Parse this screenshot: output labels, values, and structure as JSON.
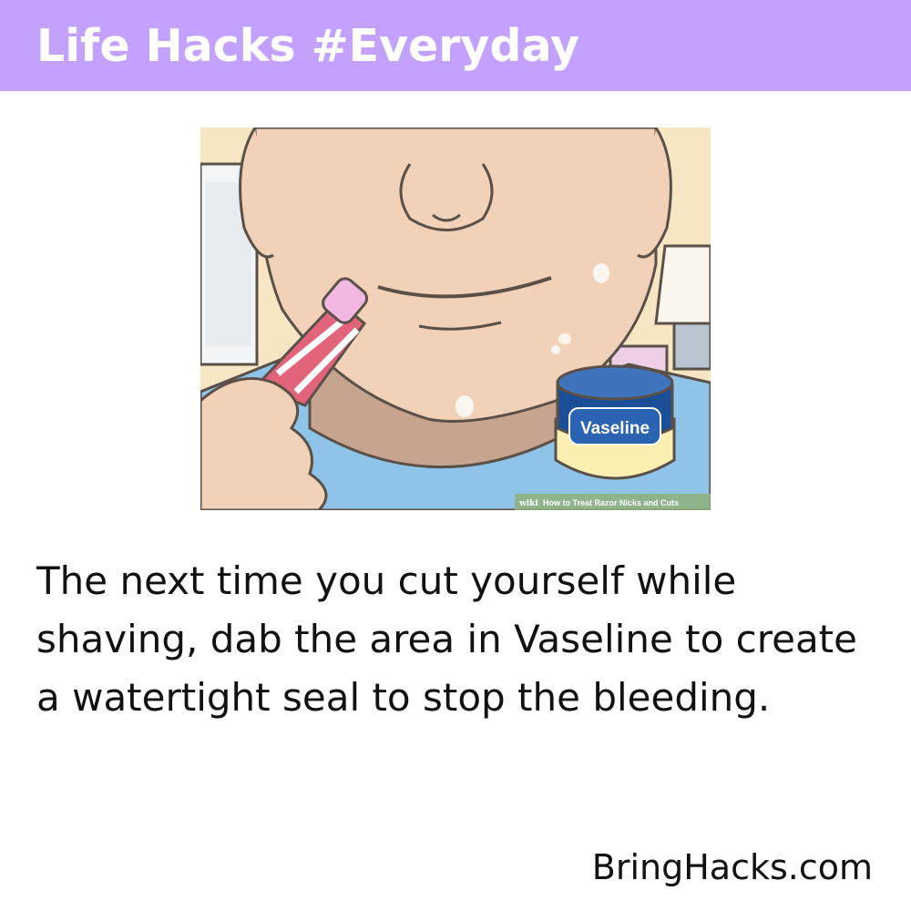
{
  "header": {
    "title": "Life Hacks #Everyday"
  },
  "illustration": {
    "jar_label": "Vaseline",
    "watermark_prefix": "wiki",
    "watermark_text": "How to Treat Razor Nicks and Cuts"
  },
  "body": {
    "text": "The next time you cut yourself while shaving, dab the area in Vaseline to create a watertight seal to stop the bleeding."
  },
  "footer": {
    "brand": "BringHacks.com"
  },
  "colors": {
    "header_bg": "#c3a1ff",
    "header_text": "#ffffff",
    "body_text": "#111111"
  }
}
